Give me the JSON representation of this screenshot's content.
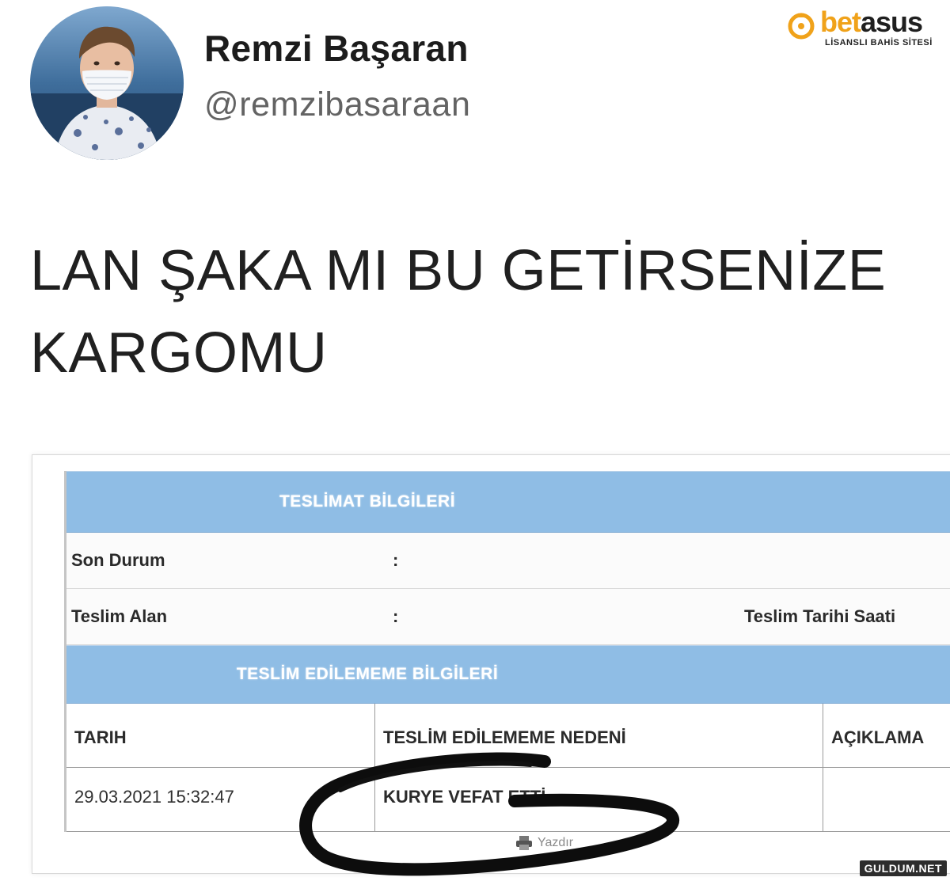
{
  "watermark": {
    "logo_word_part1": "bet",
    "logo_word_part2": "asus",
    "tagline": "LİSANSLI BAHİS SİTESİ",
    "site_mark": "GULDUM.NET",
    "accent_color": "#f0a21a"
  },
  "tweet": {
    "display_name": "Remzi Başaran",
    "handle": "@remzibasaraan",
    "text_line1": "LAN ŞAKA MI BU GETİRSENİZE",
    "text_line2": "KARGOMU"
  },
  "cargo": {
    "band_color": "#8fbde5",
    "delivery_header": "TESLİMAT BİLGİLERİ",
    "rows": [
      {
        "label": "Son Durum",
        "sep": ":"
      },
      {
        "label": "Teslim Alan",
        "sep": ":",
        "right_label": "Teslim Tarihi Saati"
      }
    ],
    "failure_header": "TESLİM EDİLEMEME BİLGİLERİ",
    "columns": [
      "TARIH",
      "TESLİM EDİLEMEME NEDENİ",
      "AÇIKLAMA"
    ],
    "entry": {
      "date": "29.03.2021 15:32:47",
      "reason": "KURYE VEFAT ETTİ",
      "note": ""
    },
    "print_label": "Yazdır"
  }
}
